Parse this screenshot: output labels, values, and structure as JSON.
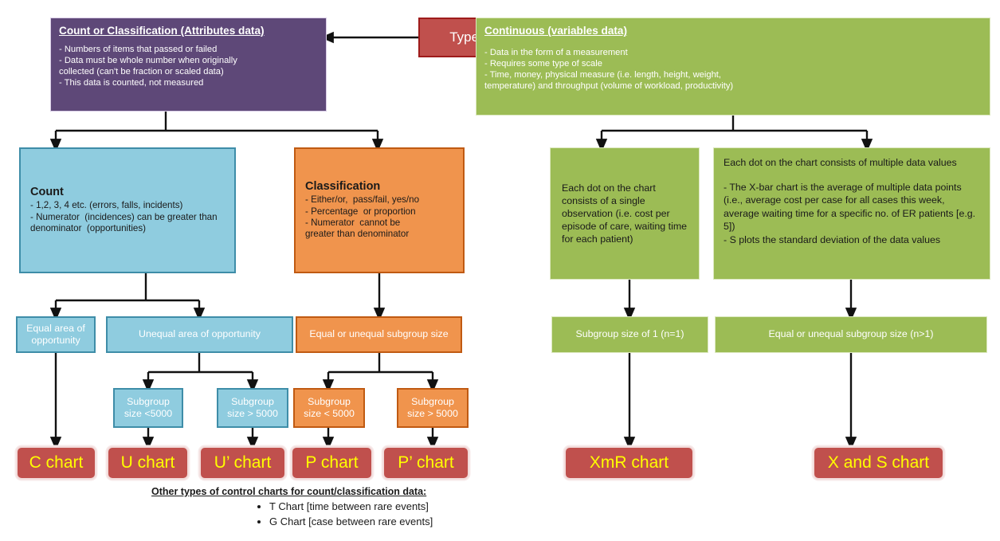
{
  "diagram": {
    "title_node": {
      "label": "Type of data"
    },
    "attributes_box": {
      "title": "Count or Classification (Attributes data)",
      "lines": [
        "- Numbers of items that passed or failed",
        "- Data must be whole number when originally",
        "collected (can't be fraction or scaled data)",
        "- This data is counted, not measured"
      ]
    },
    "continuous_box": {
      "title": "Continuous (variables data)",
      "lines": [
        "- Data in the form of a measurement",
        "- Requires some type of scale",
        "- Time, money, physical measure (i.e. length, height, weight,",
        "temperature) and throughput (volume of workload, productivity)"
      ]
    },
    "count_box": {
      "title": "Count",
      "lines": [
        "- 1,2, 3, 4 etc. (errors, falls, incidents)",
        "- Numerator  (incidences) can be greater than",
        "denominator  (opportunities)"
      ]
    },
    "classification_box": {
      "title": "Classification",
      "lines": [
        "- Either/or,  pass/fail, yes/no",
        "- Percentage  or proportion",
        "- Numerator  cannot be",
        "greater than denominator"
      ]
    },
    "single_obs_box": {
      "text": "Each dot on the chart consists of a single observation (i.e. cost per episode of care, waiting time for each patient)"
    },
    "multi_obs_box": {
      "lines": [
        "Each dot on the chart consists of multiple data values",
        "",
        "- The X-bar chart is the average of multiple data points (i.e., average cost per case for all cases this week, average waiting time for a specific no. of ER patients [e.g. 5])",
        "- S plots the standard deviation of the data values"
      ]
    },
    "equal_area": {
      "label": "Equal area of opportunity"
    },
    "unequal_area": {
      "label": "Unequal area of opportunity"
    },
    "equal_or_unequal_subgroup": {
      "label": "Equal or unequal subgroup size"
    },
    "subgroup_size_1": {
      "label": "Subgroup size of 1 (n=1)"
    },
    "subgroup_size_n": {
      "label": "Equal or unequal subgroup size (n>1)"
    },
    "blue_sub_small": {
      "label": "Subgroup size <5000"
    },
    "blue_sub_large": {
      "label": "Subgroup size > 5000"
    },
    "orange_sub_small": {
      "label": "Subgroup size < 5000"
    },
    "orange_sub_large": {
      "label": "Subgroup size > 5000"
    },
    "charts": {
      "c": "C chart",
      "u": "U chart",
      "u_prime": "U’ chart",
      "p": "P chart",
      "p_prime": "P’ chart",
      "xmr": "XmR chart",
      "xands": "X and S chart"
    },
    "footnote": {
      "title": "Other types of control charts for count/classification data:",
      "items": [
        "T Chart [time between rare events]",
        "G Chart [case between rare events]"
      ]
    },
    "colors": {
      "purple": "#5E4878",
      "red": "#C0504D",
      "green": "#9CBC55",
      "blue": "#8FCCDF",
      "orange": "#F0944D",
      "chart_text": "#FFFF00"
    }
  }
}
